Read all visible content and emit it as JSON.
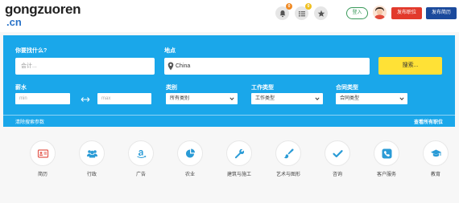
{
  "header": {
    "logo_main": "gongzuoren",
    "logo_sub": ".cn",
    "icons": [
      {
        "name": "bell-icon",
        "badge": "0",
        "badge_color": "#f08a24"
      },
      {
        "name": "list-icon",
        "badge": "0",
        "badge_color": "#f0c020"
      },
      {
        "name": "star-icon",
        "badge": "",
        "badge_color": ""
      }
    ],
    "login_label": "登入",
    "post_job_label": "发布职位",
    "post_resume_label": "发布简历"
  },
  "search": {
    "what_label": "你要找什么?",
    "what_placeholder": "会计...",
    "where_label": "地点",
    "where_value": "China",
    "search_button": "搜索...",
    "salary_label": "薪水",
    "salary_min_placeholder": "min",
    "salary_max_placeholder": "max",
    "category_label": "类别",
    "category_value": "所有类别",
    "job_type_label": "工作类型",
    "job_type_value": "工作类型",
    "contract_type_label": "合同类型",
    "contract_type_value": "合同类型",
    "clear_label": "清除搜索参数",
    "all_jobs_label": "查看所有职位"
  },
  "categories": [
    {
      "label": "简历",
      "icon": "resume-icon"
    },
    {
      "label": "行政",
      "icon": "users-icon"
    },
    {
      "label": "广告",
      "icon": "amazon-icon"
    },
    {
      "label": "农业",
      "icon": "pie-chart-icon"
    },
    {
      "label": "建筑与施工",
      "icon": "wrench-icon"
    },
    {
      "label": "艺术与图形",
      "icon": "paintbrush-icon"
    },
    {
      "label": "咨询",
      "icon": "check-icon"
    },
    {
      "label": "客户服务",
      "icon": "phone-icon"
    },
    {
      "label": "教育",
      "icon": "graduation-cap-icon"
    }
  ],
  "colors": {
    "panel": "#1aa7ea",
    "search_button": "#ffe136",
    "post_job": "#e23a2c",
    "post_resume": "#1b4a9c",
    "category_icon": "#2a9bd6",
    "resume_icon": "#e35a4f"
  }
}
